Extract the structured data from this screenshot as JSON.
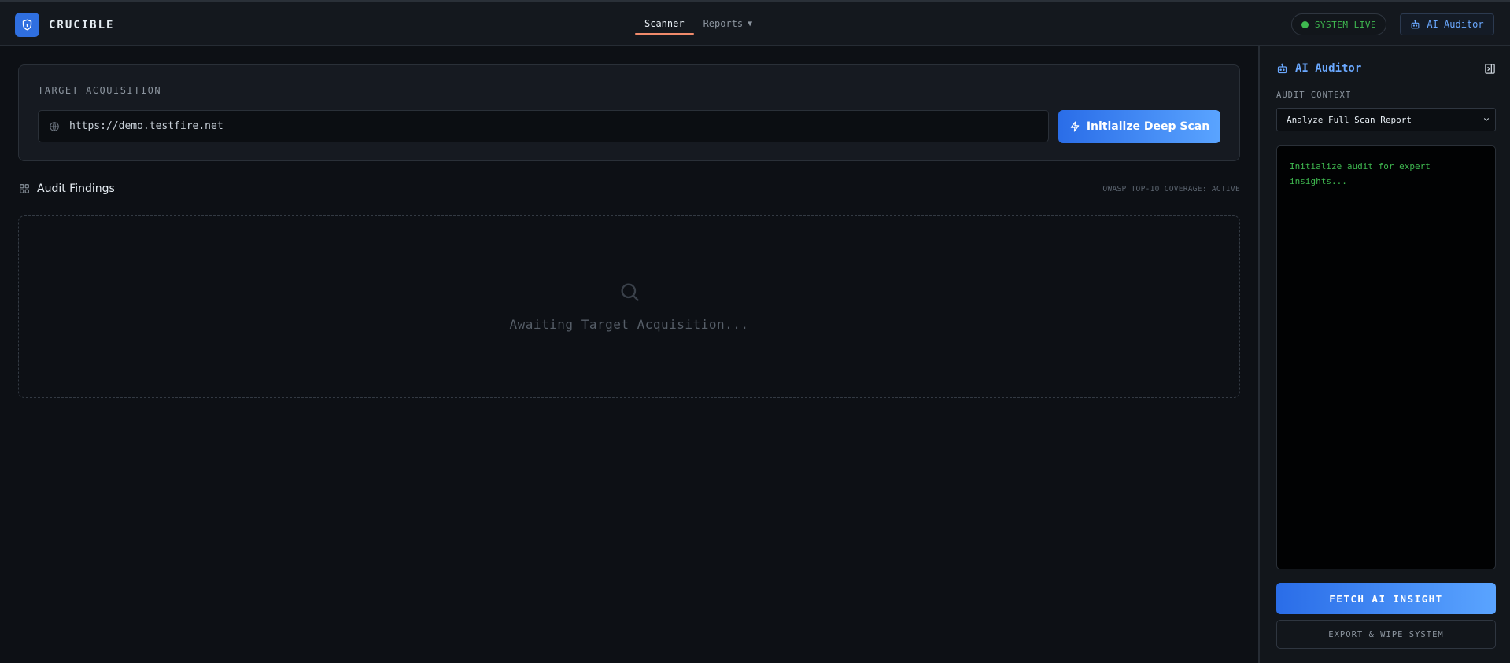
{
  "app": {
    "name": "CRUCIBLE",
    "brand_color": "#2f6fe0"
  },
  "nav": {
    "tabs": [
      {
        "label": "Scanner",
        "active": true
      },
      {
        "label": "Reports",
        "active": false,
        "caret": "▼"
      }
    ]
  },
  "header": {
    "status_label": "SYSTEM LIVE",
    "status_color": "#3fb950",
    "ai_button_label": "AI Auditor"
  },
  "target": {
    "label": "TARGET ACQUISITION",
    "url_value": "https://demo.testfire.net",
    "scan_button_label": "Initialize Deep Scan"
  },
  "findings": {
    "title": "Audit Findings",
    "coverage": "OWASP TOP-10 COVERAGE: ACTIVE",
    "empty_text": "Awaiting Target Acquisition..."
  },
  "auditor": {
    "title": "AI Auditor",
    "context_label": "AUDIT CONTEXT",
    "context_selected": "Analyze Full Scan Report",
    "console_text": "Initialize audit for expert insights...",
    "fetch_label": "FETCH AI INSIGHT",
    "wipe_label": "EXPORT & WIPE SYSTEM"
  }
}
